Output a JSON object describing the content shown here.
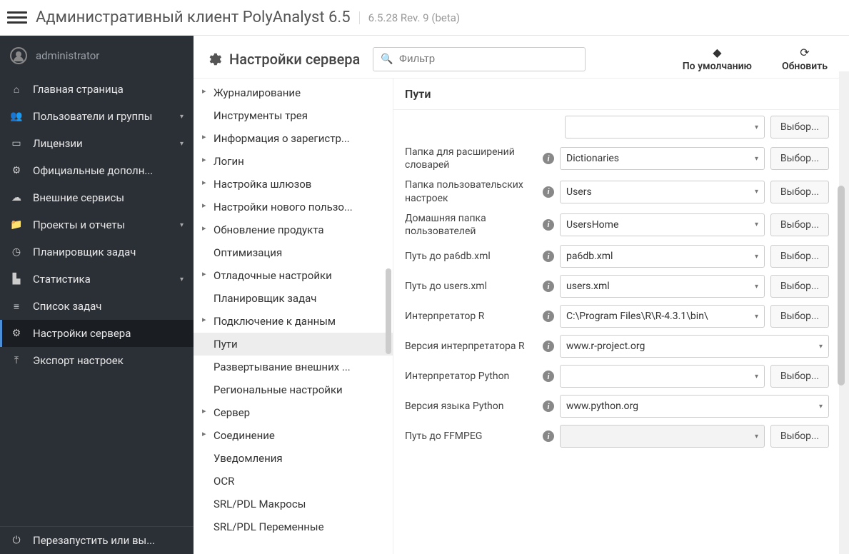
{
  "header": {
    "title": "Административный клиент PolyAnalyst 6.5",
    "version": "6.5.28 Rev. 9 (beta)"
  },
  "user": {
    "name": "administrator"
  },
  "sidebar": {
    "items": [
      {
        "icon": "home",
        "label": "Главная страница",
        "expandable": false
      },
      {
        "icon": "users",
        "label": "Пользователи и группы",
        "expandable": true
      },
      {
        "icon": "id",
        "label": "Лицензии",
        "expandable": true
      },
      {
        "icon": "puzzle",
        "label": "Официальные дополн...",
        "expandable": false
      },
      {
        "icon": "cloud",
        "label": "Внешние сервисы",
        "expandable": false
      },
      {
        "icon": "folder",
        "label": "Проекты и отчеты",
        "expandable": true
      },
      {
        "icon": "clock",
        "label": "Планировщик задач",
        "expandable": false
      },
      {
        "icon": "chart",
        "label": "Статистика",
        "expandable": true
      },
      {
        "icon": "list",
        "label": "Список задач",
        "expandable": false
      },
      {
        "icon": "gear",
        "label": "Настройки сервера",
        "expandable": false,
        "active": true
      },
      {
        "icon": "upload",
        "label": "Экспорт настроек",
        "expandable": false
      }
    ],
    "footer": {
      "icon": "power",
      "label": "Перезапустить или вы..."
    }
  },
  "pageHeader": {
    "title": "Настройки сервера",
    "filterPlaceholder": "Фильтр",
    "defaultBtn": "По умолчанию",
    "refreshBtn": "Обновить"
  },
  "tree": [
    {
      "label": "Журналирование",
      "children": true
    },
    {
      "label": "Инструменты трея",
      "children": false
    },
    {
      "label": "Информация о зарегистр...",
      "children": true
    },
    {
      "label": "Логин",
      "children": true
    },
    {
      "label": "Настройка шлюзов",
      "children": true
    },
    {
      "label": "Настройки нового пользо...",
      "children": true
    },
    {
      "label": "Обновление продукта",
      "children": true
    },
    {
      "label": "Оптимизация",
      "children": false
    },
    {
      "label": "Отладочные настройки",
      "children": true
    },
    {
      "label": "Планировщик задач",
      "children": false
    },
    {
      "label": "Подключение к данным",
      "children": true
    },
    {
      "label": "Пути",
      "children": false,
      "selected": true
    },
    {
      "label": "Развертывание внешних ...",
      "children": false
    },
    {
      "label": "Региональные настройки",
      "children": false
    },
    {
      "label": "Сервер",
      "children": true
    },
    {
      "label": "Соединение",
      "children": true
    },
    {
      "label": "Уведомления",
      "children": false
    },
    {
      "label": "OCR",
      "children": false
    },
    {
      "label": "SRL/PDL Макросы",
      "children": false
    },
    {
      "label": "SRL/PDL Переменные",
      "children": false
    }
  ],
  "detail": {
    "title": "Пути",
    "browseLabel": "Выбор...",
    "rows": [
      {
        "label": "Папка для расширений словарей",
        "value": "Dictionaries",
        "browse": true
      },
      {
        "label": "Папка пользовательских настроек",
        "value": "Users",
        "browse": true
      },
      {
        "label": "Домашняя папка пользователей",
        "value": "UsersHome",
        "browse": true
      },
      {
        "label": "Путь до pa6db.xml",
        "value": "pa6db.xml",
        "browse": true
      },
      {
        "label": "Путь до users.xml",
        "value": "users.xml",
        "browse": true
      },
      {
        "label": "Интерпретатор R",
        "value": "C:\\Program Files\\R\\R-4.3.1\\bin\\",
        "browse": true
      },
      {
        "label": "Версия интерпретатора R",
        "value": "www.r-project.org",
        "browse": false
      },
      {
        "label": "Интерпретатор Python",
        "value": "",
        "browse": true
      },
      {
        "label": "Версия языка Python",
        "value": "www.python.org",
        "browse": false
      },
      {
        "label": "Путь до FFMPEG",
        "value": "",
        "browse": true,
        "disabled": true
      }
    ]
  },
  "iconmap": {
    "home": "⌂",
    "users": "👥",
    "id": "▭",
    "puzzle": "⚙",
    "cloud": "☁",
    "folder": "📁",
    "clock": "◷",
    "chart": "▙",
    "list": "≡",
    "gear": "⚙",
    "upload": "⤒",
    "power": "⏻"
  }
}
